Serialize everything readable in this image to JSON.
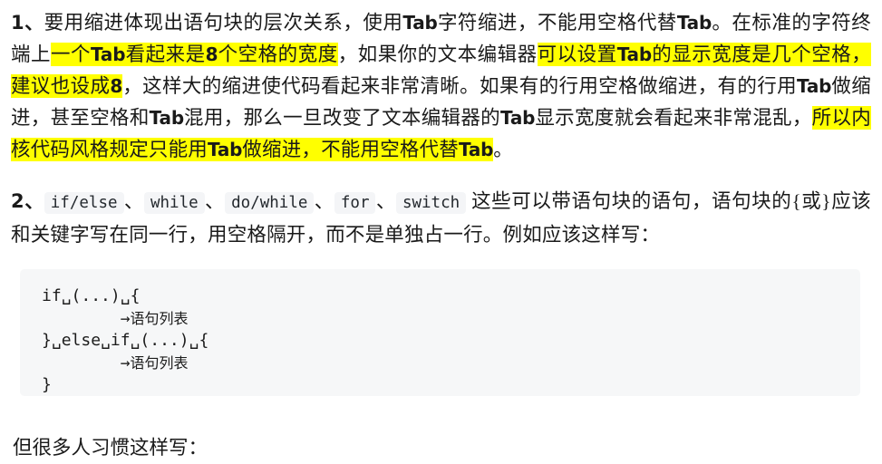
{
  "document": {
    "paragraph1": {
      "number": "1、",
      "segments": [
        {
          "text": "要用缩进体现出语句块的层次关系，使用",
          "style": "cn"
        },
        {
          "text": "Tab",
          "style": "latin"
        },
        {
          "text": "字符缩进，不能用空格代替",
          "style": "cn"
        },
        {
          "text": "Tab",
          "style": "latin"
        },
        {
          "text": "。在标准的字符终端上",
          "style": "cn"
        },
        {
          "text": "一个",
          "style": "cn-hl"
        },
        {
          "text": "Tab",
          "style": "latin-hl"
        },
        {
          "text": "看起来是",
          "style": "cn-hl"
        },
        {
          "text": "8",
          "style": "latin-hl"
        },
        {
          "text": "个空格的宽度",
          "style": "cn-hl"
        },
        {
          "text": "，如果你的文本编辑器",
          "style": "cn"
        },
        {
          "text": "可以设置",
          "style": "cn-hl"
        },
        {
          "text": "Tab",
          "style": "latin-hl"
        },
        {
          "text": "的显示宽度是几个空格，建议也设成",
          "style": "cn-hl"
        },
        {
          "text": "8",
          "style": "latin-hl"
        },
        {
          "text": "，这样大的缩进使代码看起来非常清晰。如果有的行用空格做缩进，有的行用",
          "style": "cn"
        },
        {
          "text": "Tab",
          "style": "latin"
        },
        {
          "text": "做缩进，甚至空格和",
          "style": "cn"
        },
        {
          "text": "Tab",
          "style": "latin"
        },
        {
          "text": "混用，那么一旦改变了文本编辑器的",
          "style": "cn"
        },
        {
          "text": "Tab",
          "style": "latin"
        },
        {
          "text": "显示宽度就会看起来非常混乱，",
          "style": "cn"
        },
        {
          "text": "所以内核代码风格规定只能用",
          "style": "cn-hl"
        },
        {
          "text": "Tab",
          "style": "latin-hl"
        },
        {
          "text": "做缩进，不能用空格代替",
          "style": "cn-hl"
        },
        {
          "text": "Tab",
          "style": "latin-hl"
        },
        {
          "text": "。",
          "style": "cn"
        }
      ],
      "full_text": "1、要用缩进体现出语句块的层次关系，使用Tab字符缩进，不能用空格代替Tab。在标准的字符终端上一个Tab看起来是8个空格的宽度，如果你的文本编辑器可以设置Tab的显示宽度是几个空格，建议也设成8，这样大的缩进使代码看起来非常清晰。如果有的行用空格做缩进，有的行用Tab做缩进，甚至空格和Tab混用，那么一旦改变了文本编辑器的Tab显示宽度就会看起来非常混乱，所以内核代码风格规定只能用Tab做缩进，不能用空格代替Tab。",
      "highlight_color": "#ffff00",
      "highlighted_phrases": [
        "一个Tab看起来是8个空格的宽度",
        "可以设置Tab的显示宽度是几个空格，建议也设成8",
        "所以内核代码风格规定只能用Tab做缩进，不能用空格代替Tab"
      ]
    },
    "paragraph2": {
      "number": "2、",
      "code_keywords": [
        "if/else",
        "while",
        "do/while",
        "for",
        "switch"
      ],
      "separator": "、",
      "text_after_keywords": "这些可以带语句块的语句，语句块的{或}",
      "text_line2": "应该和关键字写在同一行，用空格隔开，而不是单独占一行。例如应该这样写：",
      "inline_code_bg": "#f4f5f7",
      "full_text": "2、if/else、while、do/while、for、switch 这些可以带语句块的语句，语句块的{或}应该和关键字写在同一行，用空格隔开，而不是单独占一行。例如应该这样写："
    },
    "code_block": {
      "background": "#f6f7f8",
      "space_marker": "␣",
      "tab_marker": "→",
      "lines": [
        {
          "parts": [
            {
              "t": "if",
              "k": "code"
            },
            {
              "t": "␣",
              "k": "ws"
            },
            {
              "t": "(...)",
              "k": "code"
            },
            {
              "t": "␣",
              "k": "ws"
            },
            {
              "t": "{",
              "k": "code"
            }
          ]
        },
        {
          "parts": [
            {
              "t": "        ",
              "k": "code"
            },
            {
              "t": "→",
              "k": "ws"
            },
            {
              "t": "语句列表",
              "k": "cn"
            }
          ]
        },
        {
          "parts": [
            {
              "t": "}",
              "k": "code"
            },
            {
              "t": "␣",
              "k": "ws"
            },
            {
              "t": "else",
              "k": "code"
            },
            {
              "t": "␣",
              "k": "ws"
            },
            {
              "t": "if",
              "k": "code"
            },
            {
              "t": "␣",
              "k": "ws"
            },
            {
              "t": "(...)",
              "k": "code"
            },
            {
              "t": "␣",
              "k": "ws"
            },
            {
              "t": "{",
              "k": "code"
            }
          ]
        },
        {
          "parts": [
            {
              "t": "        ",
              "k": "code"
            },
            {
              "t": "→",
              "k": "ws"
            },
            {
              "t": "语句列表",
              "k": "cn"
            }
          ]
        },
        {
          "parts": [
            {
              "t": "}",
              "k": "code"
            }
          ]
        }
      ],
      "plain_text": "if␣(...)␣{\n        →语句列表\n}␣else␣if␣(...)␣{\n        →语句列表\n}"
    },
    "closing_line": "但很多人习惯这样写："
  }
}
